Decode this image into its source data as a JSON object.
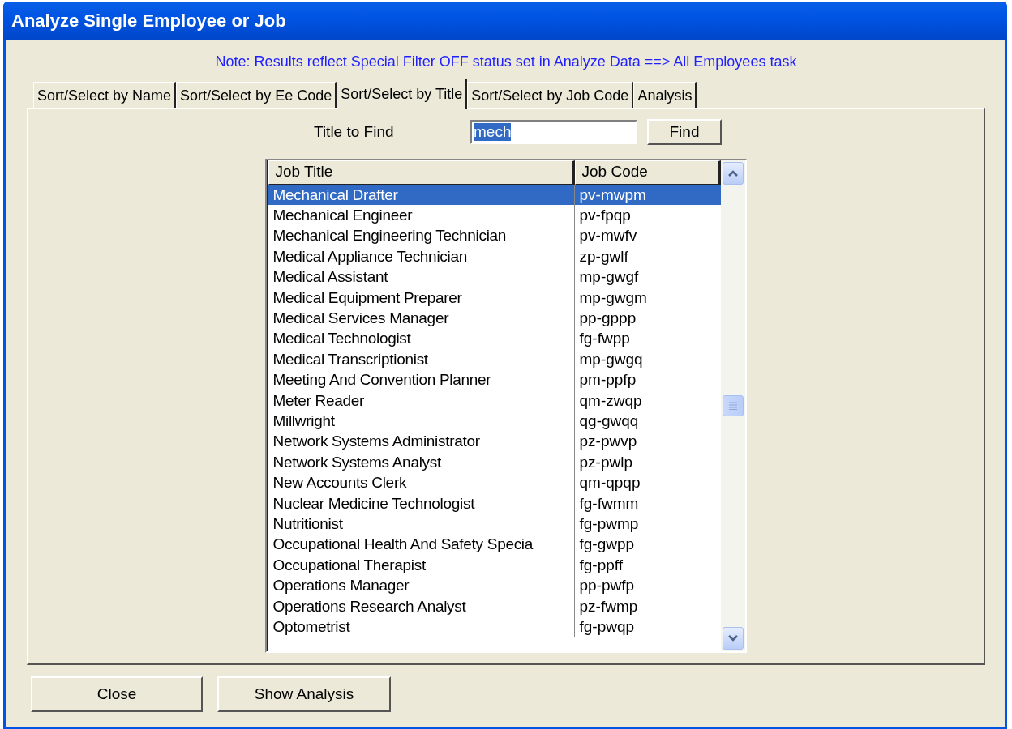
{
  "window": {
    "title": "Analyze Single Employee or Job"
  },
  "note": "Note: Results reflect Special Filter OFF status set in Analyze Data ==> All Employees task",
  "tabs": [
    {
      "label": "Sort/Select by Name",
      "selected": false
    },
    {
      "label": "Sort/Select by Ee Code",
      "selected": false
    },
    {
      "label": "Sort/Select by Title",
      "selected": true
    },
    {
      "label": "Sort/Select by Job Code",
      "selected": false
    },
    {
      "label": "Analysis",
      "selected": false
    }
  ],
  "find": {
    "label": "Title to Find",
    "value": "mech",
    "text_selected": true,
    "button": "Find"
  },
  "table": {
    "columns": [
      "Job Title",
      "Job Code"
    ],
    "rows": [
      {
        "title": "Mechanical Drafter",
        "code": "pv-mwpm",
        "selected": true
      },
      {
        "title": "Mechanical Engineer",
        "code": "pv-fpqp",
        "selected": false
      },
      {
        "title": "Mechanical Engineering Technician",
        "code": "pv-mwfv",
        "selected": false
      },
      {
        "title": "Medical Appliance Technician",
        "code": "zp-gwlf",
        "selected": false
      },
      {
        "title": "Medical Assistant",
        "code": "mp-gwgf",
        "selected": false
      },
      {
        "title": "Medical Equipment Preparer",
        "code": "mp-gwgm",
        "selected": false
      },
      {
        "title": "Medical Services Manager",
        "code": "pp-gppp",
        "selected": false
      },
      {
        "title": "Medical Technologist",
        "code": "fg-fwpp",
        "selected": false
      },
      {
        "title": "Medical Transcriptionist",
        "code": "mp-gwgq",
        "selected": false
      },
      {
        "title": "Meeting And Convention Planner",
        "code": "pm-ppfp",
        "selected": false
      },
      {
        "title": "Meter Reader",
        "code": "qm-zwqp",
        "selected": false
      },
      {
        "title": "Millwright",
        "code": "qg-gwqq",
        "selected": false
      },
      {
        "title": "Network Systems Administrator",
        "code": "pz-pwvp",
        "selected": false
      },
      {
        "title": "Network Systems Analyst",
        "code": "pz-pwlp",
        "selected": false
      },
      {
        "title": "New Accounts Clerk",
        "code": "qm-qpqp",
        "selected": false
      },
      {
        "title": "Nuclear Medicine Technologist",
        "code": "fg-fwmm",
        "selected": false
      },
      {
        "title": "Nutritionist",
        "code": "fg-pwmp",
        "selected": false
      },
      {
        "title": "Occupational Health And Safety Specia",
        "code": "fg-gwpp",
        "selected": false
      },
      {
        "title": "Occupational Therapist",
        "code": "fg-ppff",
        "selected": false
      },
      {
        "title": "Operations Manager",
        "code": "pp-pwfp",
        "selected": false
      },
      {
        "title": "Operations Research Analyst",
        "code": "pz-fwmp",
        "selected": false
      },
      {
        "title": "Optometrist",
        "code": "fg-pwqp",
        "selected": false
      }
    ]
  },
  "buttons": [
    "Close",
    "Show Analysis"
  ]
}
